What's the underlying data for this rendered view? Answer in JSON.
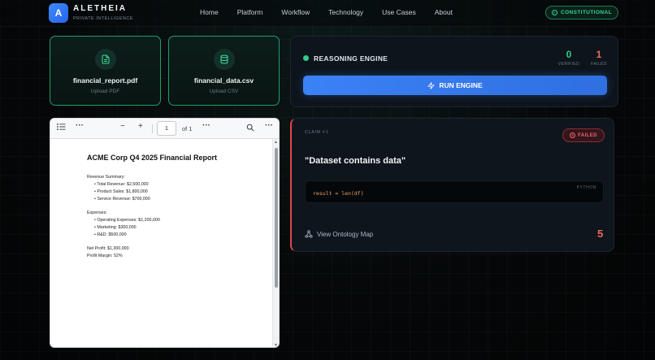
{
  "brand": {
    "logo_letter": "A",
    "name": "ALETHEIA",
    "tagline": "PRIVATE INTELLIGENCE"
  },
  "nav": {
    "links": [
      "Home",
      "Platform",
      "Workflow",
      "Technology",
      "Use Cases",
      "About"
    ]
  },
  "status_badge": {
    "label": "CONSTITUTIONAL",
    "color": "#39d38f",
    "icon": "check-circle-icon"
  },
  "uploads": [
    {
      "filename": "financial_report.pdf",
      "hint": "Upload PDF",
      "icon": "document-icon"
    },
    {
      "filename": "financial_data.csv",
      "hint": "Upload CSV",
      "icon": "database-icon"
    }
  ],
  "engine": {
    "title": "REASONING ENGINE",
    "verified_count": "0",
    "verified_label": "VERIFIED",
    "failed_count": "1",
    "failed_label": "FAILED",
    "run_label": "RUN ENGINE",
    "accent": "#3b82f6"
  },
  "pdf_viewer": {
    "current_page": "1",
    "total_pages": "of 1",
    "document": {
      "title": "ACME Corp Q4 2025 Financial Report",
      "revenue_heading": "Revenue Summary:",
      "revenue_items": [
        "• Total Revenue: $2,500,000",
        "• Product Sales: $1,800,000",
        "• Service Revenue: $700,000"
      ],
      "expenses_heading": "Expenses:",
      "expense_items": [
        "• Operating Expenses: $1,200,000",
        "• Marketing: $300,000",
        "• R&D: $500,000"
      ],
      "net_profit": "Net Profit: $1,300,000",
      "profit_margin": "Profit Margin: 52%"
    }
  },
  "claim": {
    "label": "CLAIM #1",
    "status": "FAILED",
    "status_color": "#f0656a",
    "text": "\"Dataset contains data\"",
    "code_lang": "PYTHON",
    "code": "result = len(df)",
    "link_label": "View Ontology Map",
    "score": "5"
  }
}
